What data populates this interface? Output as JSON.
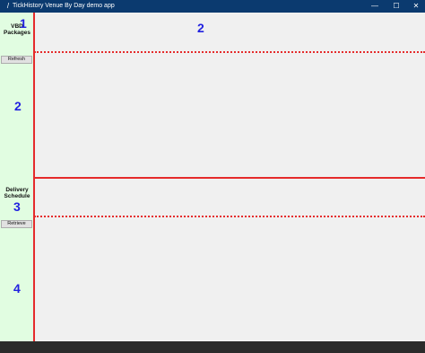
{
  "window": {
    "title": "TickHistory Venue By Day demo app",
    "app_icon": "/",
    "minimize_glyph": "—",
    "maximize_glyph": "☐",
    "close_glyph": "✕"
  },
  "sections": {
    "vbd_label": "VBD Packages",
    "delivery_label": "Delivery Schedule",
    "refresh_button": "Refresh",
    "retrieve_button": "Retrieve"
  },
  "markers": {
    "m1": "1",
    "m2a": "2",
    "m2b": "2",
    "m3": "3",
    "m4": "4"
  },
  "colors": {
    "titlebar": "#0b3a6f",
    "sidebar": "#e1fde1",
    "separator": "#e52b2b",
    "marker": "#2121e0",
    "background": "#f0f0f0"
  }
}
